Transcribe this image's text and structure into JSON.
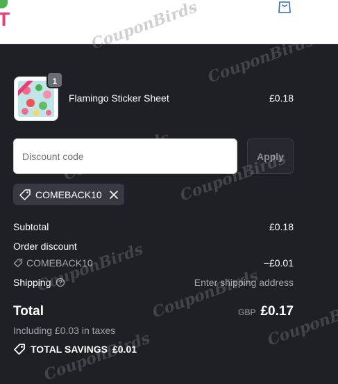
{
  "header": {
    "logo_letter": "T"
  },
  "cart": {
    "items": [
      {
        "name": "Flamingo Sticker Sheet",
        "quantity": "1",
        "price": "£0.18"
      }
    ]
  },
  "discount": {
    "placeholder": "Discount code",
    "apply_label": "Apply",
    "applied_code": "COMEBACK10"
  },
  "summary": {
    "subtotal_label": "Subtotal",
    "subtotal_value": "£0.18",
    "order_discount_label": "Order discount",
    "discount_code": "COMEBACK10",
    "discount_value": "−£0.01",
    "shipping_label": "Shipping",
    "shipping_value": "Enter shipping address",
    "total_label": "Total",
    "total_currency": "GBP",
    "total_value": "£0.17",
    "tax_note": "Including £0.03 in taxes",
    "savings_label": "TOTAL SAVINGS",
    "savings_value": "£0.01"
  },
  "watermark": "CouponBirds",
  "colors": {
    "background": "#1f2026",
    "chip": "#373943",
    "brand_pink": "#e93d74",
    "brand_green": "#4caf50"
  }
}
